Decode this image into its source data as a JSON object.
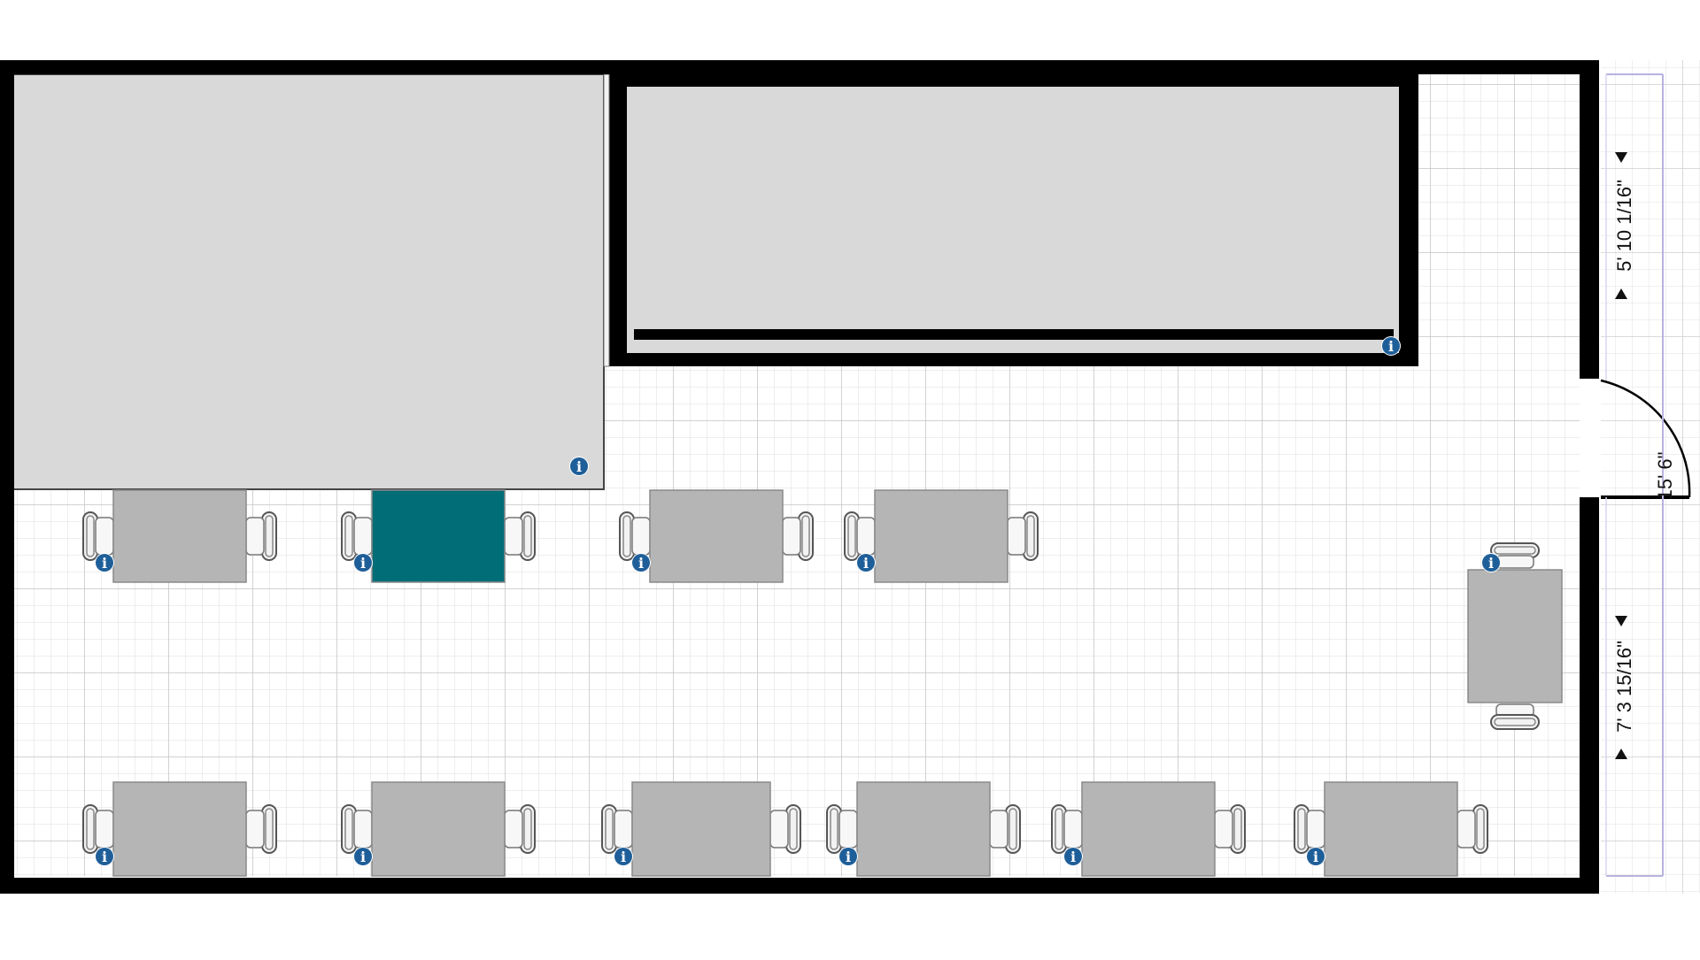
{
  "colors": {
    "wall": "#000000",
    "floor_grid_minor": "#dcdcdc",
    "floor_grid_major": "#c4c4c4",
    "area_fill": "#d9d9d9",
    "desk_fill": "#b5b5b5",
    "desk_selected_fill": "#006d77",
    "chair_fill": "#f2f2f2",
    "chair_stroke": "#555555",
    "info_badge": "#1f5f99",
    "dimension_guide": "#b7b3e0"
  },
  "icons": {
    "info": "info-icon",
    "chair": "office-chair-icon",
    "door": "door-swing-icon",
    "arrow": "dimension-arrow-icon"
  },
  "dimensions": {
    "upper_wall_segment": "5' 10 1/16\"",
    "door_width": "15' 6\"",
    "lower_wall_segment": "7' 3 15/16\""
  },
  "info_badge_glyph": "i",
  "selected_desk": "desk-row1-2"
}
